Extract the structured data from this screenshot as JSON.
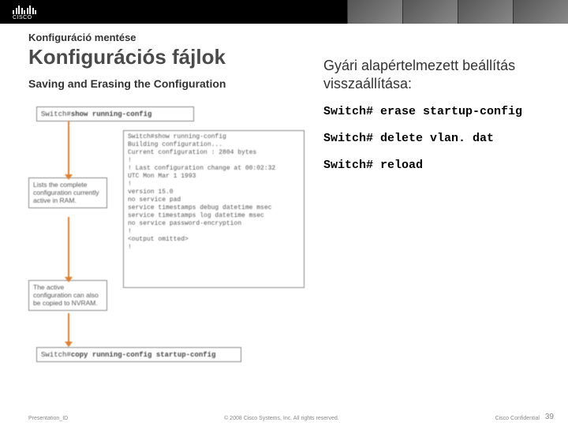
{
  "logo_text": "CISCO",
  "header": {
    "subtitle": "Konfiguráció mentése",
    "title": "Konfigurációs fájlok",
    "section": "Saving and Erasing the Configuration"
  },
  "diagram": {
    "cmd1_prompt": "Switch#",
    "cmd1_bold": "show running-config",
    "output": "Switch#show running-config\nBuilding configuration...\nCurrent configuration : 2804 bytes\n!\n! Last configuration change at 00:02:32\nUTC Mon Mar 1 1993\n!\nversion 15.0\nno service pad\nservice timestamps debug datetime msec\nservice timestamps log datetime msec\nno service password-encryption\n!\n<output omitted>\n!",
    "desc1": "Lists the complete configuration currently active in RAM.",
    "desc2": "The active configuration can also be copied to NVRAM.",
    "cmd2_prompt": "Switch#",
    "cmd2_bold": "copy running-config startup-config"
  },
  "right": {
    "title": "Gyári alapértelmezett beállítás visszaállítása:",
    "cmd1": "Switch# erase startup-config",
    "cmd2": "Switch#   delete vlan. dat",
    "cmd3": "Switch# reload"
  },
  "footer": {
    "left": "Presentation_ID",
    "center": "© 2008 Cisco Systems, Inc. All rights reserved.",
    "right": "Cisco Confidential",
    "page": "39"
  }
}
